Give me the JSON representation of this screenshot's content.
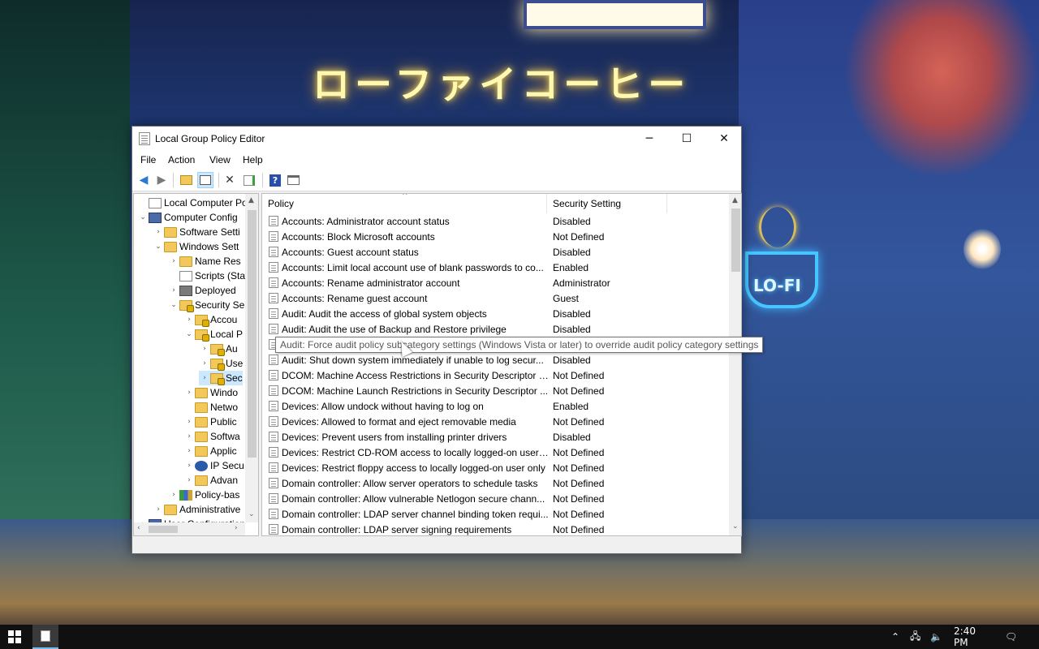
{
  "window": {
    "title": "Local Group Policy Editor",
    "controls": {
      "minimize": "─",
      "maximize": "☐",
      "close": "✕"
    }
  },
  "menu": [
    "File",
    "Action",
    "View",
    "Help"
  ],
  "toolbar": {
    "icons": [
      "back-arrow-icon",
      "forward-arrow-icon",
      "up-folder-icon",
      "show-hide-tree-icon",
      "delete-icon",
      "export-list-icon",
      "help-icon",
      "properties-icon"
    ]
  },
  "tree": {
    "items": [
      {
        "label": "Local Computer Polic",
        "arrow": "",
        "icon": "root"
      },
      {
        "label": "Computer Config",
        "arrow": "⌄",
        "icon": "comp"
      },
      {
        "label": "Software Setti",
        "arrow": "›",
        "icon": "folder"
      },
      {
        "label": "Windows Sett",
        "arrow": "⌄",
        "icon": "folder"
      },
      {
        "label": "Name Res",
        "arrow": "›",
        "icon": "folder"
      },
      {
        "label": "Scripts (Sta",
        "arrow": "",
        "icon": "doc"
      },
      {
        "label": "Deployed",
        "arrow": "›",
        "icon": "deploy"
      },
      {
        "label": "Security Se",
        "arrow": "⌄",
        "icon": "lock"
      },
      {
        "label": "Accou",
        "arrow": "›",
        "icon": "lock"
      },
      {
        "label": "Local P",
        "arrow": "⌄",
        "icon": "lock"
      },
      {
        "label": "Au",
        "arrow": "›",
        "icon": "lock"
      },
      {
        "label": "Use",
        "arrow": "›",
        "icon": "lock"
      },
      {
        "label": "Sec",
        "arrow": "›",
        "icon": "lock"
      },
      {
        "label": "Windo",
        "arrow": "›",
        "icon": "folder"
      },
      {
        "label": "Netwo",
        "arrow": "",
        "icon": "folder"
      },
      {
        "label": "Public",
        "arrow": "›",
        "icon": "folder"
      },
      {
        "label": "Softwa",
        "arrow": "›",
        "icon": "folder"
      },
      {
        "label": "Applic",
        "arrow": "›",
        "icon": "folder"
      },
      {
        "label": "IP Secu",
        "arrow": "›",
        "icon": "ip"
      },
      {
        "label": "Advan",
        "arrow": "›",
        "icon": "folder"
      },
      {
        "label": "Policy-bas",
        "arrow": "›",
        "icon": "chart"
      },
      {
        "label": "Administrative",
        "arrow": "›",
        "icon": "folder"
      },
      {
        "label": "User Configuration",
        "arrow": "›",
        "icon": "comp"
      }
    ],
    "selected_index": 12
  },
  "list": {
    "columns": {
      "policy": "Policy",
      "setting": "Security Setting"
    },
    "rows": [
      {
        "policy": "Accounts: Administrator account status",
        "setting": "Disabled"
      },
      {
        "policy": "Accounts: Block Microsoft accounts",
        "setting": "Not Defined"
      },
      {
        "policy": "Accounts: Guest account status",
        "setting": "Disabled"
      },
      {
        "policy": "Accounts: Limit local account use of blank passwords to co...",
        "setting": "Enabled"
      },
      {
        "policy": "Accounts: Rename administrator account",
        "setting": "Administrator"
      },
      {
        "policy": "Accounts: Rename guest account",
        "setting": "Guest"
      },
      {
        "policy": "Audit: Audit the access of global system objects",
        "setting": "Disabled"
      },
      {
        "policy": "Audit: Audit the use of Backup and Restore privilege",
        "setting": "Disabled"
      },
      {
        "policy": "Audit: Force audit policy subcategory settings (Windows Vista or later) to override audit policy category settings",
        "setting": ""
      },
      {
        "policy": "Audit: Shut down system immediately if unable to log secur...",
        "setting": "Disabled"
      },
      {
        "policy": "DCOM: Machine Access Restrictions in Security Descriptor D...",
        "setting": "Not Defined"
      },
      {
        "policy": "DCOM: Machine Launch Restrictions in Security Descriptor ...",
        "setting": "Not Defined"
      },
      {
        "policy": "Devices: Allow undock without having to log on",
        "setting": "Enabled"
      },
      {
        "policy": "Devices: Allowed to format and eject removable media",
        "setting": "Not Defined"
      },
      {
        "policy": "Devices: Prevent users from installing printer drivers",
        "setting": "Disabled"
      },
      {
        "policy": "Devices: Restrict CD-ROM access to locally logged-on user ...",
        "setting": "Not Defined"
      },
      {
        "policy": "Devices: Restrict floppy access to locally logged-on user only",
        "setting": "Not Defined"
      },
      {
        "policy": "Domain controller: Allow server operators to schedule tasks",
        "setting": "Not Defined"
      },
      {
        "policy": "Domain controller: Allow vulnerable Netlogon secure chann...",
        "setting": "Not Defined"
      },
      {
        "policy": "Domain controller: LDAP server channel binding token requi...",
        "setting": "Not Defined"
      },
      {
        "policy": "Domain controller: LDAP server signing requirements",
        "setting": "Not Defined"
      }
    ]
  },
  "tooltip": "Audit: Force audit policy subcategory settings (Windows Vista or later) to override audit policy category settings",
  "wallpaper": {
    "neon_sign": "ローファイコーヒー",
    "cup_sign": "LO-FI"
  },
  "taskbar": {
    "time": "2:40 PM",
    "tray_icons": [
      "chevron-up-icon",
      "network-icon",
      "volume-muted-icon",
      "notifications-icon"
    ]
  },
  "colors": {
    "selection": "#cce8ff",
    "taskbar": "#101010",
    "accent": "#76b9ed"
  }
}
